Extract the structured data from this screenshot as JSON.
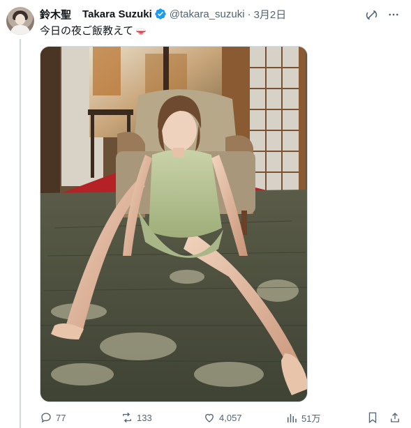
{
  "post": {
    "author_name": "鈴木聖",
    "author_name_en": "Takara Suzuki",
    "handle": "@takara_suzuki",
    "separator": "·",
    "date": "3月2日",
    "text": "今日の夜ご飯教えて"
  },
  "icons": {
    "verified": "verified-badge-icon",
    "grok": "grok-icon",
    "more": "more-icon",
    "rice": "rice-bowl-emoji",
    "reply": "reply-icon",
    "repost": "repost-icon",
    "like": "like-icon",
    "views": "views-icon",
    "bookmark": "bookmark-icon",
    "share": "share-icon"
  },
  "actions": {
    "replies": "77",
    "reposts": "133",
    "likes": "4,057",
    "views": "51万"
  },
  "colors": {
    "verified": "#1d9bf0",
    "text": "#0f1419",
    "secondary": "#536471",
    "divider": "#cfd9de"
  }
}
